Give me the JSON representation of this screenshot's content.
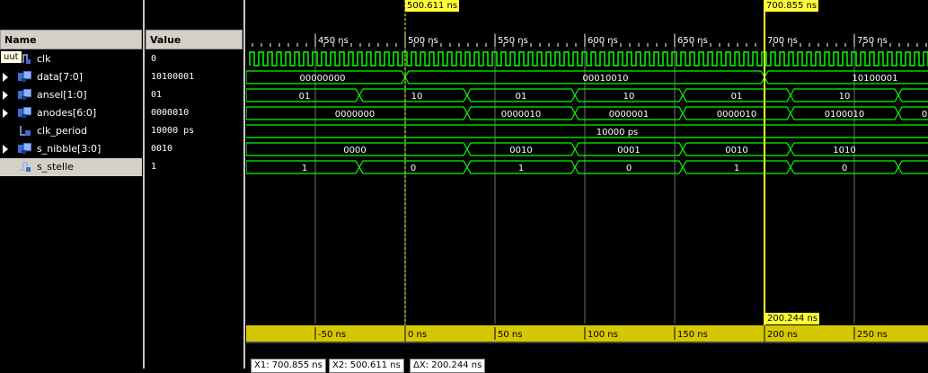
{
  "columns": {
    "name": "Name",
    "value": "Value"
  },
  "tooltip": "uut",
  "signals": [
    {
      "name": "clk",
      "value": "0",
      "expandable": false,
      "icon": "bit-signal-icon"
    },
    {
      "name": "data[7:0]",
      "value": "10100001",
      "expandable": true,
      "icon": "bus-signal-icon"
    },
    {
      "name": "ansel[1:0]",
      "value": "01",
      "expandable": true,
      "icon": "bus-signal-icon"
    },
    {
      "name": "anodes[6:0]",
      "value": "0000010",
      "expandable": true,
      "icon": "bus-signal-icon"
    },
    {
      "name": "clk_period",
      "value": "10000 ps",
      "expandable": false,
      "icon": "constant-icon"
    },
    {
      "name": "s_nibble[3:0]",
      "value": "0010",
      "expandable": true,
      "icon": "bus-signal-icon"
    },
    {
      "name": "s_stelle",
      "value": "1",
      "expandable": false,
      "icon": "bit-signal-icon"
    }
  ],
  "cursors": {
    "x1": "700.855 ns",
    "x2": "500.611 ns",
    "delta": "200.244 ns"
  },
  "top_ticks": [
    "450 ns",
    "500 ns",
    "550 ns",
    "600 ns",
    "650 ns",
    "700 ns",
    "750 ns"
  ],
  "bottom_ticks": [
    "-50 ns",
    "0 ns",
    "50 ns",
    "100 ns",
    "150 ns",
    "200 ns",
    "250 ns"
  ],
  "waves": {
    "data": [
      "00000000",
      "00010010",
      "10100001"
    ],
    "ansel": [
      "01",
      "10",
      "01",
      "10",
      "01",
      "10"
    ],
    "anodes": [
      "0000000",
      "0000010",
      "0000001",
      "0000010",
      "0100010",
      "0"
    ],
    "clk_period": "10000 ps",
    "s_nibble": [
      "0000",
      "0010",
      "0001",
      "0010",
      "1010"
    ],
    "s_stelle": [
      "1",
      "0",
      "1",
      "0",
      "1",
      "0"
    ]
  },
  "status": {
    "x1": "X1: 700.855 ns",
    "x2": "X2: 500.611 ns",
    "dx": "ΔX: 200.244 ns"
  },
  "colors": {
    "wave": "#00ff00",
    "cursor": "#ffff3a",
    "timeline_bar": "#d6c800"
  }
}
